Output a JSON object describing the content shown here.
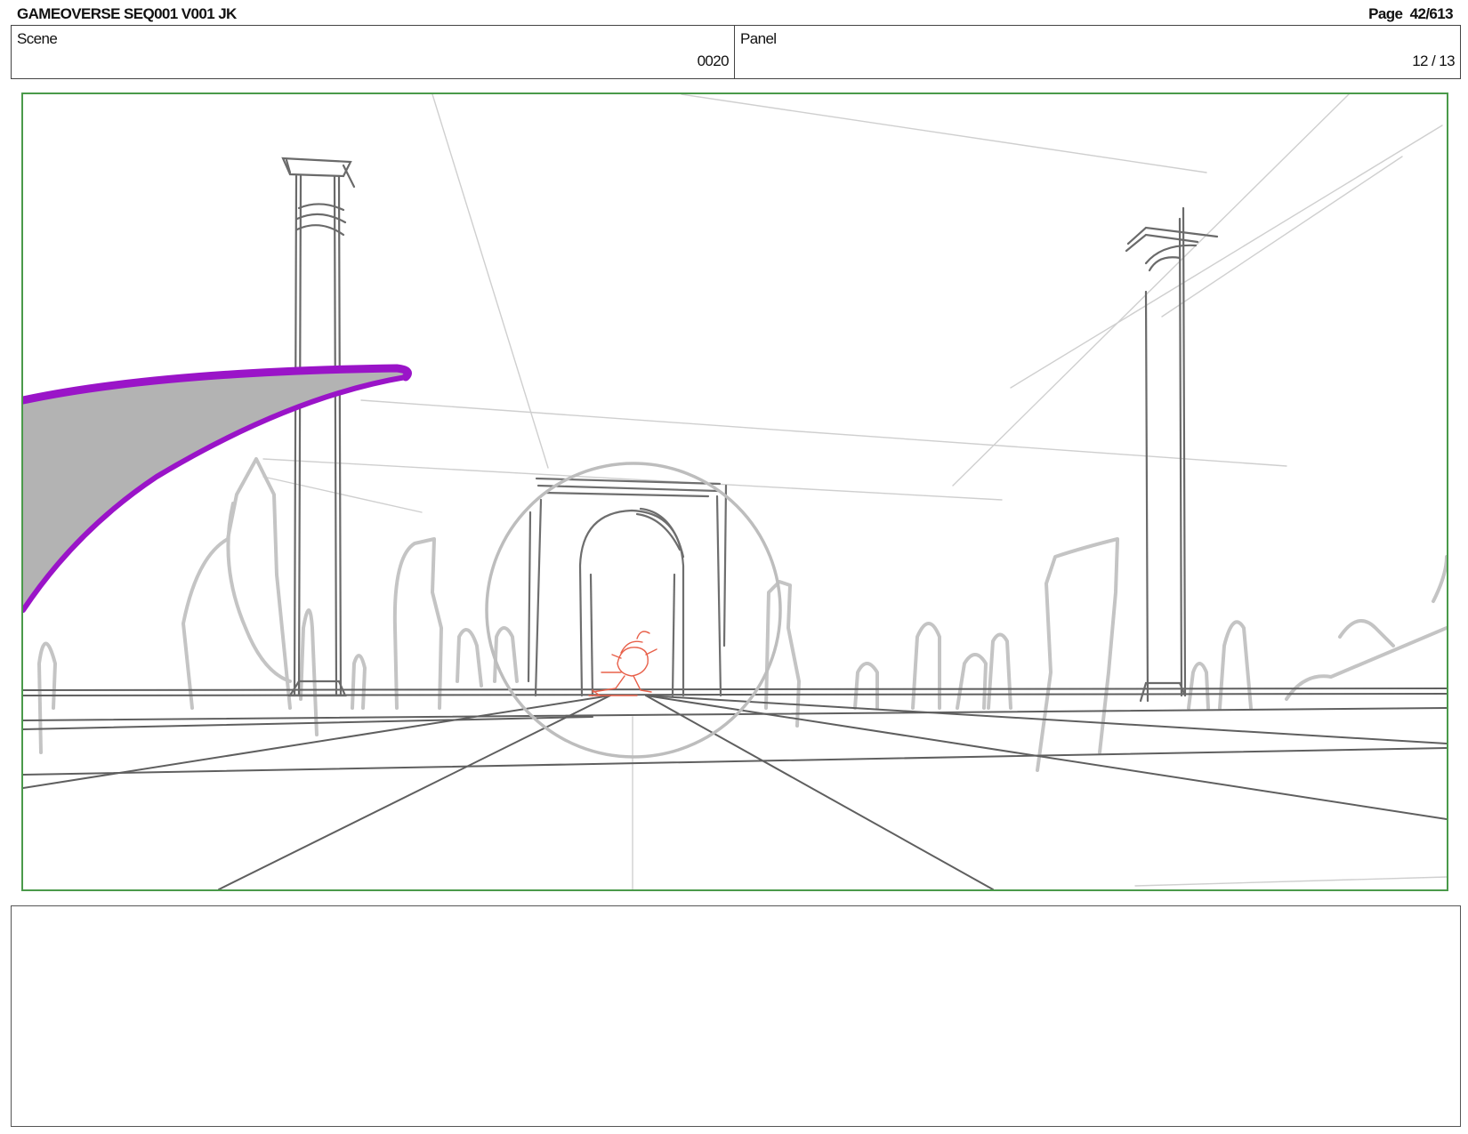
{
  "header": {
    "title": "GAMEOVERSE SEQ001 V001 JK",
    "page_label": "Page  42/613"
  },
  "scene": {
    "label": "Scene",
    "value": "0020"
  },
  "panel": {
    "label": "Panel",
    "value": "12 / 13"
  },
  "colors": {
    "frame_border": "#4a9a4a",
    "sketch_dark": "#666666",
    "sketch_light": "#c8c8c8",
    "shape_fill": "#b3b3b3",
    "shape_outline": "#9a14c8",
    "character_lines": "#e8604a"
  },
  "notes": {
    "text": ""
  }
}
